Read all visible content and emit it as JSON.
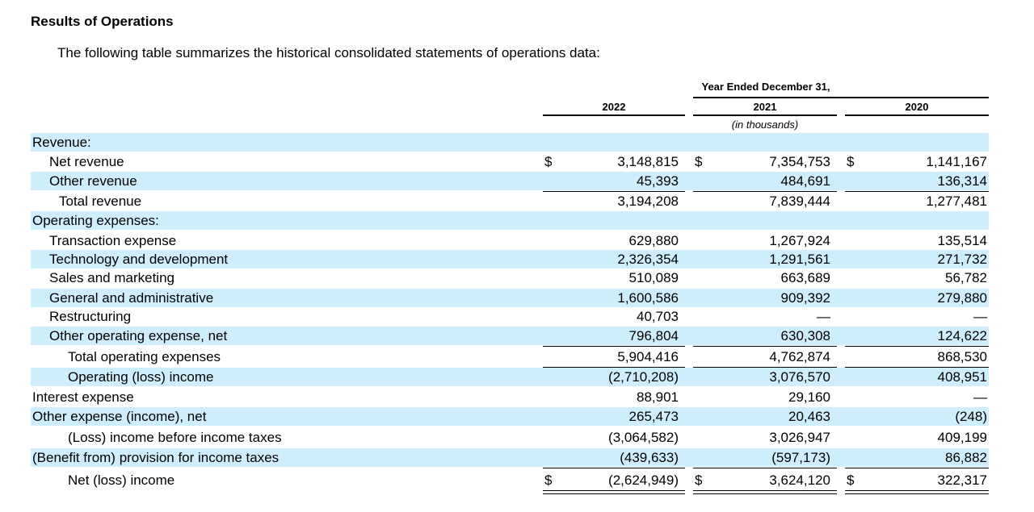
{
  "heading": "Results of Operations",
  "intro": "The following table summarizes the historical consolidated statements of operations data:",
  "header": {
    "period": "Year Ended December 31,",
    "years": [
      "2022",
      "2021",
      "2020"
    ],
    "unit": "(in thousands)"
  },
  "currency_symbol": "$",
  "rows": [
    {
      "label": "Revenue:",
      "values": [
        "",
        "",
        ""
      ]
    },
    {
      "label": "Net revenue",
      "values": [
        "3,148,815",
        "7,354,753",
        "1,141,167"
      ]
    },
    {
      "label": "Other revenue",
      "values": [
        "45,393",
        "484,691",
        "136,314"
      ]
    },
    {
      "label": "Total revenue",
      "values": [
        "3,194,208",
        "7,839,444",
        "1,277,481"
      ]
    },
    {
      "label": "Operating expenses:",
      "values": [
        "",
        "",
        ""
      ]
    },
    {
      "label": "Transaction expense",
      "values": [
        "629,880",
        "1,267,924",
        "135,514"
      ]
    },
    {
      "label": "Technology and development",
      "values": [
        "2,326,354",
        "1,291,561",
        "271,732"
      ]
    },
    {
      "label": "Sales and marketing",
      "values": [
        "510,089",
        "663,689",
        "56,782"
      ]
    },
    {
      "label": "General and administrative",
      "values": [
        "1,600,586",
        "909,392",
        "279,880"
      ]
    },
    {
      "label": "Restructuring",
      "values": [
        "40,703",
        "—",
        "—"
      ]
    },
    {
      "label": "Other operating expense, net",
      "values": [
        "796,804",
        "630,308",
        "124,622"
      ]
    },
    {
      "label": "Total operating expenses",
      "values": [
        "5,904,416",
        "4,762,874",
        "868,530"
      ]
    },
    {
      "label": "Operating (loss) income",
      "values": [
        "(2,710,208)",
        "3,076,570",
        "408,951"
      ]
    },
    {
      "label": "Interest expense",
      "values": [
        "88,901",
        "29,160",
        "—"
      ]
    },
    {
      "label": "Other expense (income), net",
      "values": [
        "265,473",
        "20,463",
        "(248)"
      ]
    },
    {
      "label": "(Loss) income before income taxes",
      "values": [
        "(3,064,582)",
        "3,026,947",
        "409,199"
      ]
    },
    {
      "label": "(Benefit from) provision for income taxes",
      "values": [
        "(439,633)",
        "(597,173)",
        "86,882"
      ]
    },
    {
      "label": "Net (loss) income",
      "values": [
        "(2,624,949)",
        "3,624,120",
        "322,317"
      ]
    }
  ]
}
